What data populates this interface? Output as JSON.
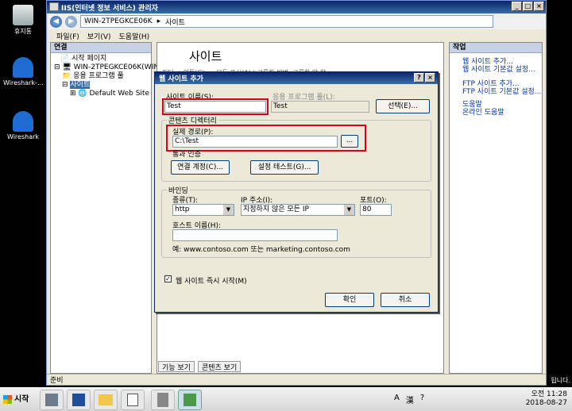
{
  "desktop": {
    "icons": [
      {
        "label": "휴지통"
      },
      {
        "label": "Wireshark-..."
      },
      {
        "label": "Wireshark"
      }
    ],
    "right_edge_text": "됩니다."
  },
  "window": {
    "title": "IIS(인터넷 정보 서비스) 관리자",
    "address": {
      "host": "WIN-2TPEGKCE06K",
      "sep": "▸",
      "path": "사이트"
    },
    "menus": [
      "파일(F)",
      "보기(V)",
      "도움말(H)"
    ],
    "connections": {
      "title": "연결",
      "tree": [
        "시작 페이지",
        "WIN-2TPEGKCE06K(WIN",
        "응용 프로그램 풀",
        "사이트",
        "Default Web Site"
      ]
    },
    "center": {
      "title": "사이트",
      "filter_label": "필터:",
      "filter_rest": "▾ 이동(G) - ▾ 모두 표시(A) | 그룹화 방법: 그룹화 안 함"
    },
    "bottom_tabs": [
      "기능 보기",
      "콘텐츠 보기"
    ],
    "actions": {
      "title": "작업",
      "items": [
        "웹 사이트 추가...",
        "웹 사이트 기본값 설정...",
        "FTP 사이트 추가...",
        "FTP 사이트 기본값 설정...",
        "도움말",
        "온라인 도움말"
      ]
    },
    "status": "준비"
  },
  "dialog": {
    "title": "웹 사이트 추가",
    "site_name_label": "사이트 이름(S):",
    "site_name_value": "Test",
    "app_pool_label": "응용 프로그램 풀(L):",
    "app_pool_value": "Test",
    "select_button": "선택(E)...",
    "content_dir_label": "콘텐츠 디렉터리",
    "physical_path_label": "실제 경로(P):",
    "physical_path_value": "C:\\Test",
    "browse_button": "...",
    "pass_through_label": "통과 인증",
    "connect_as_button": "연결 계정(C)...",
    "test_settings_button": "설정 테스트(G)...",
    "binding_label": "바인딩",
    "type_label": "종류(T):",
    "type_value": "http",
    "ip_label": "IP 주소(I):",
    "ip_value": "지정하지 않은 모든 IP",
    "port_label": "포트(O):",
    "port_value": "80",
    "hostname_label": "호스트 이름(H):",
    "hostname_value": "",
    "example_text": "예: www.contoso.com 또는 marketing.contoso.com",
    "start_immediately_label": "웹 사이트 즉시 시작(M)",
    "start_checked": "✓",
    "ok_button": "확인",
    "cancel_button": "취소"
  },
  "taskbar": {
    "start_label": "시작",
    "tray_symbols": [
      "A",
      "漢",
      "?"
    ],
    "time": "오전 11:28",
    "date": "2018-08-27"
  },
  "colors": {
    "highlight": "#d9001b",
    "title_bar": "#0a246a"
  }
}
